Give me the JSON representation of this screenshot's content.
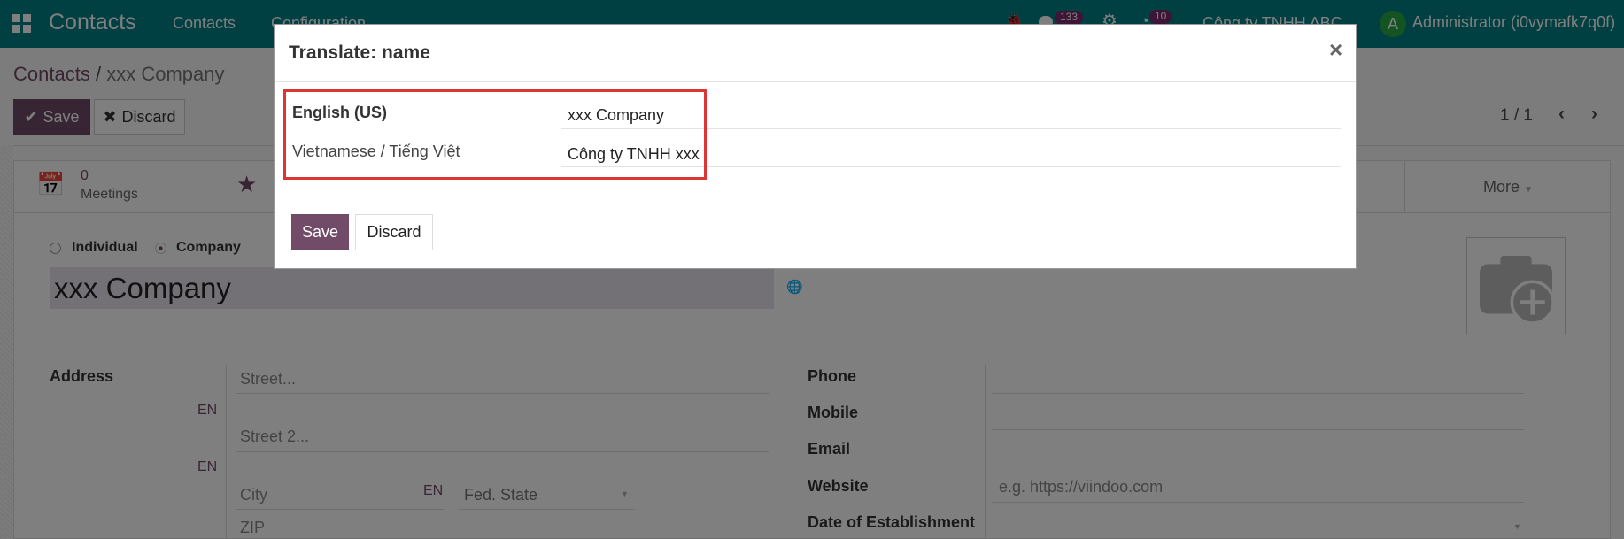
{
  "navbar": {
    "app_title": "Contacts",
    "menu": [
      "Contacts",
      "Configuration"
    ],
    "messages_count": "133",
    "activities_count": "10",
    "company": "Công ty TNHH ABC",
    "user_initial": "A",
    "user": "Administrator (i0vymafk7q0f)"
  },
  "breadcrumb": {
    "root": "Contacts",
    "separator": "/",
    "current": "xxx Company"
  },
  "toolbar": {
    "save": "Save",
    "discard": "Discard",
    "pager": "1 / 1"
  },
  "button_box": {
    "meetings_count": "0",
    "meetings_label": "Meetings",
    "more": "More"
  },
  "form": {
    "company_type_options": [
      "Individual",
      "Company"
    ],
    "company_type_selected": "Company",
    "name": "xxx Company",
    "address_label": "Address",
    "street_placeholder": "Street...",
    "street2_placeholder": "Street 2...",
    "city_placeholder": "City",
    "state_placeholder": "Fed. State",
    "zip_placeholder": "ZIP",
    "lang_tag": "EN",
    "phone_label": "Phone",
    "mobile_label": "Mobile",
    "email_label": "Email",
    "website_label": "Website",
    "website_placeholder": "e.g. https://viindoo.com",
    "date_label": "Date of Establishment"
  },
  "dialog": {
    "title": "Translate: name",
    "close": "×",
    "rows": [
      {
        "language": "English (US)",
        "value": "xxx Company"
      },
      {
        "language": "Vietnamese / Tiếng Việt",
        "value": "Công ty TNHH xxx"
      }
    ],
    "save": "Save",
    "discard": "Discard"
  },
  "colors": {
    "navbar": "#017e84",
    "primary": "#714b67",
    "highlight": "#dc3535"
  }
}
